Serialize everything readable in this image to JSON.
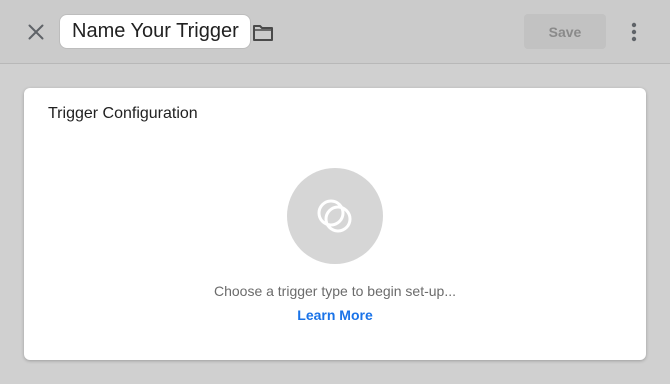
{
  "header": {
    "trigger_name": "Name Your Trigger",
    "save_label": "Save",
    "icons": {
      "close": "close-icon",
      "folder": "folder-icon",
      "more": "more-vertical-icon"
    }
  },
  "card": {
    "title": "Trigger Configuration",
    "prompt": "Choose a trigger type to begin set-up...",
    "learn_more": "Learn More",
    "icon": "trigger-type-icon"
  },
  "colors": {
    "accent": "#1a73e8",
    "topbar_bg": "#cbcbcb",
    "page_bg": "#d0d0d0",
    "save_disabled_bg": "#c2c2c2"
  }
}
